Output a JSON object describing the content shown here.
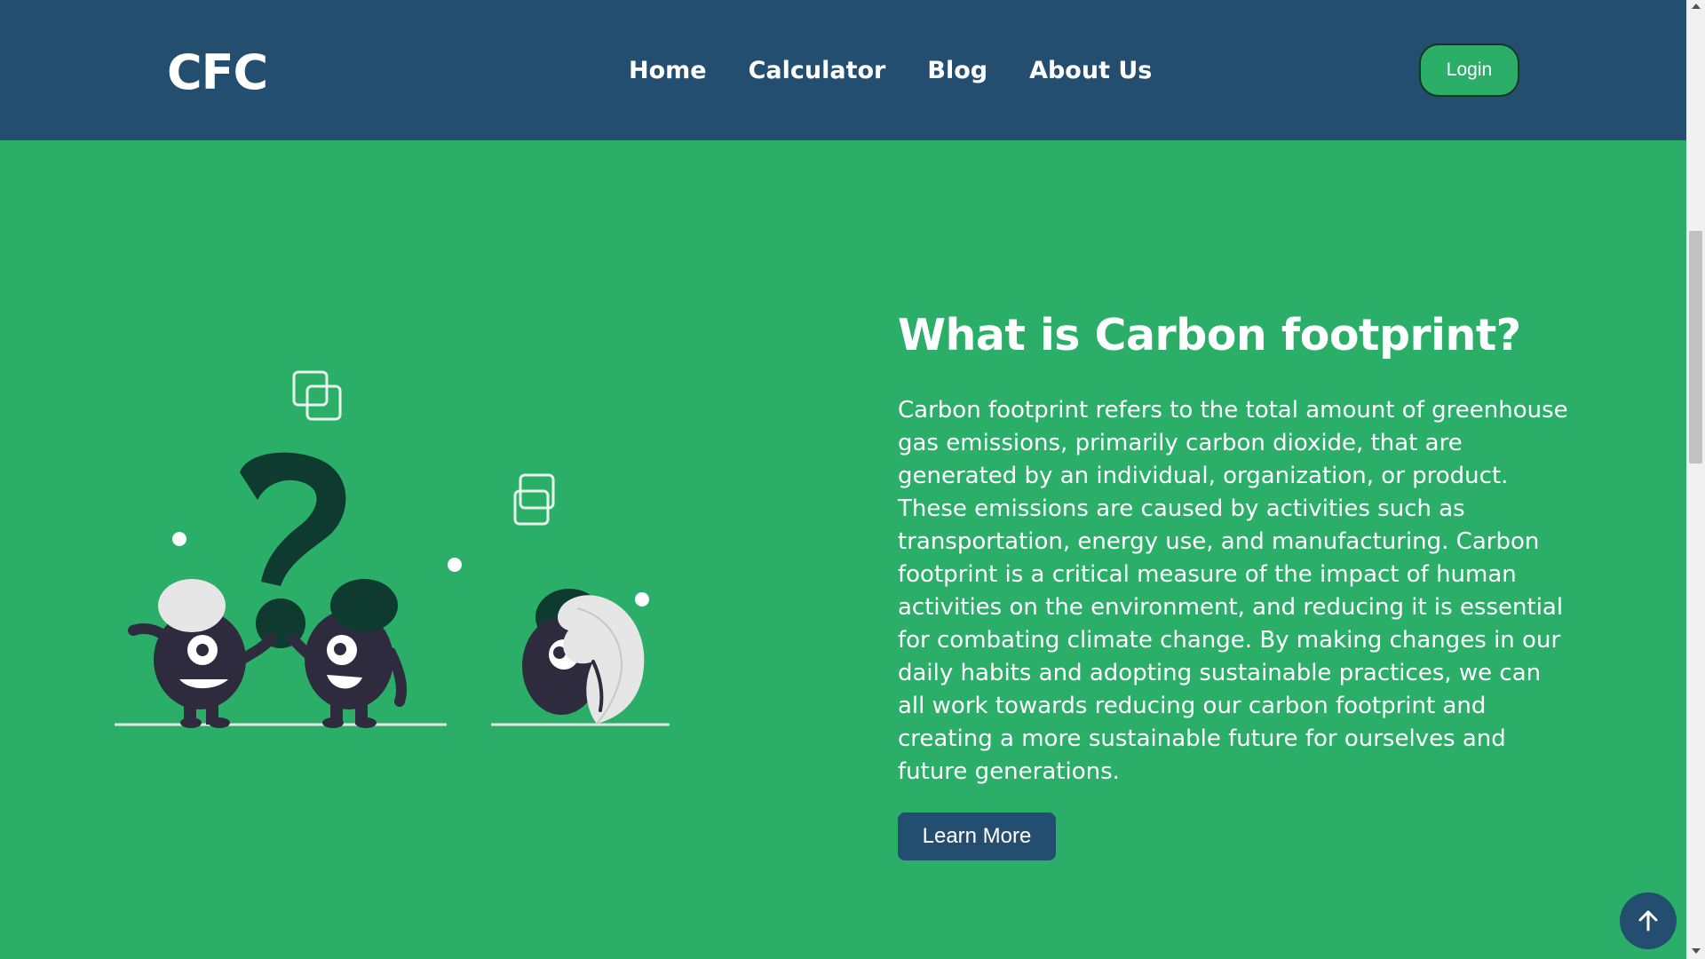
{
  "header": {
    "logo": "CFC",
    "nav": [
      {
        "label": "Home"
      },
      {
        "label": "Calculator"
      },
      {
        "label": "Blog"
      },
      {
        "label": "About Us"
      }
    ],
    "login_label": "Login"
  },
  "hero": {
    "heading": "What is Carbon footprint?",
    "paragraph": "Carbon footprint refers to the total amount of greenhouse gas emissions, primarily carbon dioxide, that are generated by an individual, organization, or product. These emissions are caused by activities such as transportation, energy use, and manufacturing. Carbon footprint is a critical measure of the impact of human activities on the environment, and reducing it is essential for combating climate change. By making changes in our daily habits and adopting sustainable practices, we can all work towards reducing our carbon footprint and creating a more sustainable future for ourselves and future generations.",
    "cta_label": "Learn More",
    "illustration_icon": "question-characters-illustration"
  },
  "back_to_top_icon": "arrow-up-icon",
  "colors": {
    "header_bg": "#244e70",
    "page_bg": "#2baf68",
    "dark_green": "#0f3a30",
    "character_dark": "#2f2b3e"
  }
}
